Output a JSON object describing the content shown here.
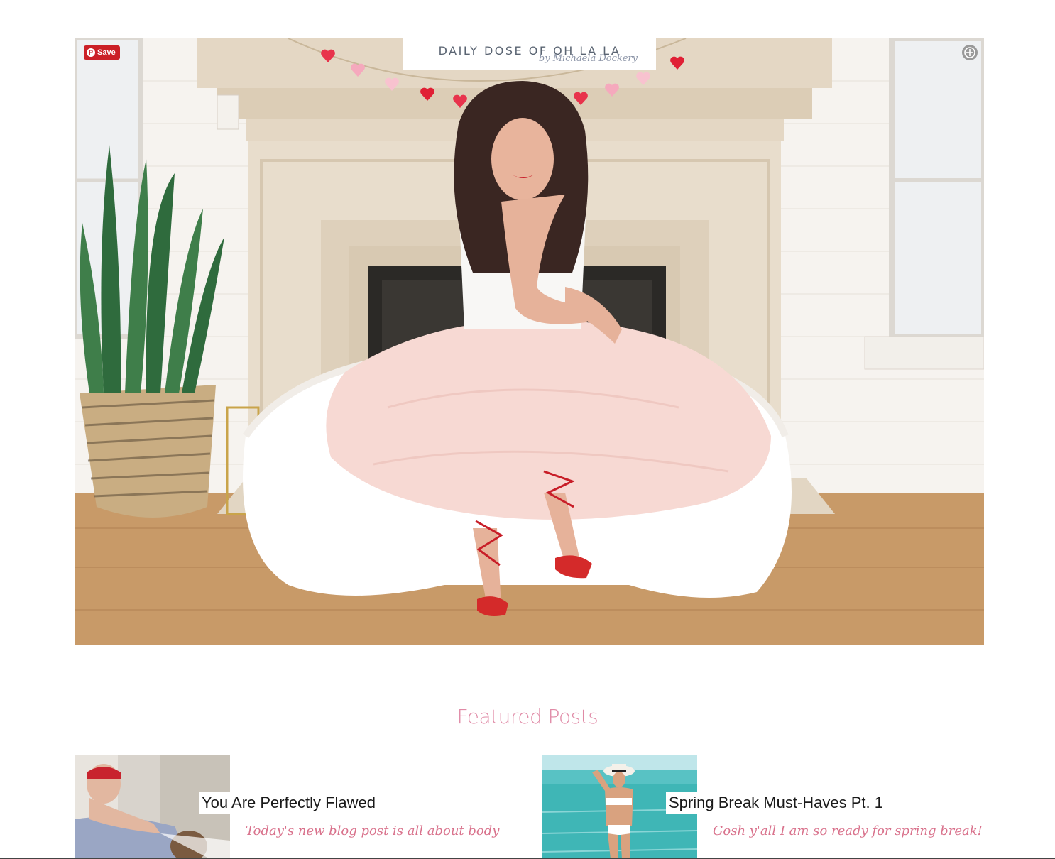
{
  "brand": {
    "title": "DAILY DOSE OF OH LA LA",
    "subtitle": "by Michaela Dockery"
  },
  "hero": {
    "pin_label": "Save",
    "expand_icon": "expand-icon"
  },
  "featured": {
    "heading": "Featured Posts",
    "posts": [
      {
        "title": "You Are Perfectly Flawed",
        "excerpt": "Today's new blog post is all about body"
      },
      {
        "title": "Spring Break Must-Haves Pt. 1",
        "excerpt": "Gosh y'all I am so ready for spring break!"
      }
    ]
  },
  "colors": {
    "accent_pink": "#e08aa6",
    "excerpt_pink": "#d9728c",
    "pinterest_red": "#cb2027"
  }
}
